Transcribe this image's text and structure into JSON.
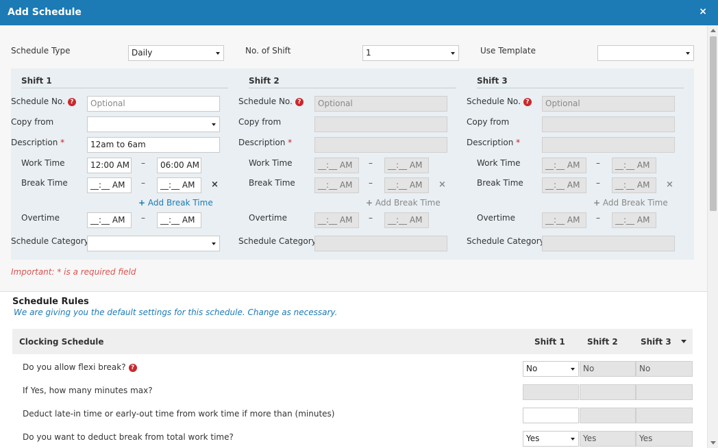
{
  "dialog": {
    "title": "Add Schedule",
    "close": "×"
  },
  "top": {
    "schedule_type_label": "Schedule Type",
    "schedule_type_value": "Daily",
    "no_of_shift_label": "No. of Shift",
    "no_of_shift_value": "1",
    "use_template_label": "Use Template",
    "use_template_value": ""
  },
  "labels": {
    "schedule_no": "Schedule No.",
    "copy_from": "Copy from",
    "description": "Description",
    "required_star": "*",
    "work_time": "Work Time",
    "break_time": "Break Time",
    "add_break_time": "Add Break Time",
    "overtime": "Overtime",
    "schedule_category": "Schedule Category",
    "dash": "–",
    "remove": "×",
    "plus": "+",
    "help": "?"
  },
  "shift1": {
    "title": "Shift 1",
    "schedule_no_placeholder": "Optional",
    "copy_from": "",
    "description": "12am to 6am",
    "work_start": "12:00 AM",
    "work_end": "06:00 AM",
    "break_start": "__:__ AM",
    "break_end": "__:__ AM",
    "overtime_start": "__:__ AM",
    "overtime_end": "__:__ AM",
    "category": ""
  },
  "shift2": {
    "title": "Shift 2",
    "schedule_no_placeholder": "Optional",
    "work_start": "__:__ AM",
    "work_end": "__:__ AM",
    "break_start": "__:__ AM",
    "break_end": "__:__ AM",
    "overtime_start": "__:__ AM",
    "overtime_end": "__:__ AM"
  },
  "shift3": {
    "title": "Shift 3",
    "schedule_no_placeholder": "Optional",
    "work_start": "__:__ AM",
    "work_end": "__:__ AM",
    "break_start": "__:__ AM",
    "break_end": "__:__ AM",
    "overtime_start": "__:__ AM",
    "overtime_end": "__:__ AM"
  },
  "important_note": "Important: * is a required field",
  "rules": {
    "title": "Schedule Rules",
    "subtitle": "We are giving you the default settings for this schedule. Change as necessary.",
    "section": "Clocking Schedule",
    "col_shift1": "Shift 1",
    "col_shift2": "Shift 2",
    "col_shift3": "Shift 3",
    "rows": [
      {
        "question": "Do you allow flexi break?",
        "s1": "No",
        "s2": "No",
        "s3": "No"
      },
      {
        "question": "If Yes, how many minutes max?",
        "s1": "",
        "s2": "",
        "s3": ""
      },
      {
        "question": "Deduct late-in time or early-out time from work time if more than (minutes)",
        "s1": "",
        "s2": "",
        "s3": ""
      },
      {
        "question": "Do you want to deduct break from total work time?",
        "s1": "Yes",
        "s2": "Yes",
        "s3": "Yes"
      }
    ]
  },
  "colors": {
    "header": "#1c7ab5",
    "required": "#cc1f1f",
    "link": "#1c7ab5",
    "panel": "#e9eff3"
  }
}
